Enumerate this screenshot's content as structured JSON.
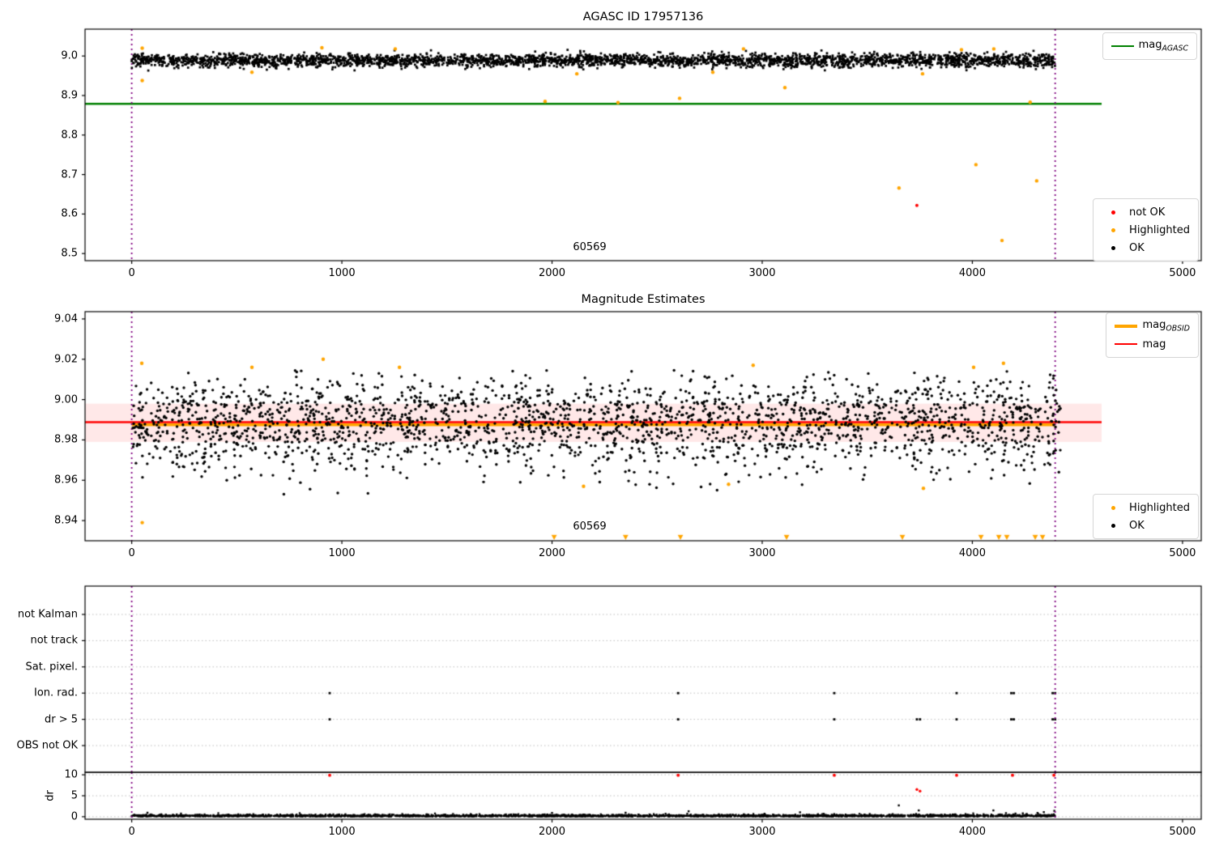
{
  "colors": {
    "green": "#008000",
    "red": "#ff0000",
    "orange": "#ffa500",
    "purple": "#800080",
    "black": "#000000",
    "band_fill": "rgba(255,0,0,0.09)",
    "grid": "#bcbcbc"
  },
  "chart_data": [
    {
      "type": "scatter",
      "title": "AGASC ID 17957136",
      "annotation": "60569",
      "xlim": [
        -222,
        5089
      ],
      "ylim": [
        8.482,
        9.068
      ],
      "xticks": [
        {
          "v": 0,
          "label": "0"
        },
        {
          "v": 1000,
          "label": "1000"
        },
        {
          "v": 2000,
          "label": "2000"
        },
        {
          "v": 3000,
          "label": "3000"
        },
        {
          "v": 4000,
          "label": "4000"
        },
        {
          "v": 5000,
          "label": "5000"
        }
      ],
      "yticks": [
        {
          "v": 9.0,
          "label": "9.0"
        },
        {
          "v": 8.9,
          "label": "8.9"
        },
        {
          "v": 8.8,
          "label": "8.8"
        },
        {
          "v": 8.7,
          "label": "8.7"
        },
        {
          "v": 8.6,
          "label": "8.6"
        },
        {
          "v": 8.5,
          "label": "8.5"
        }
      ],
      "agasc_mag_line": {
        "y": 8.879,
        "x_start": -222,
        "x_end": 4615
      },
      "vlines": [
        0,
        4394
      ],
      "ok_band": {
        "n": 3200,
        "x_min": 0,
        "x_max": 4394,
        "mean": 8.989,
        "sigma": 0.0085,
        "clip": [
          8.958,
          9.016
        ]
      },
      "highlighted": [
        [
          50,
          9.02
        ],
        [
          572,
          8.959
        ],
        [
          905,
          9.021
        ],
        [
          1254,
          9.018
        ],
        [
          1967,
          8.885
        ],
        [
          2118,
          8.955
        ],
        [
          2314,
          8.882
        ],
        [
          2607,
          8.893
        ],
        [
          2765,
          8.959
        ],
        [
          2911,
          9.018
        ],
        [
          3108,
          8.92
        ],
        [
          3651,
          8.666
        ],
        [
          3763,
          8.955
        ],
        [
          3948,
          9.016
        ],
        [
          4017,
          8.725
        ],
        [
          4102,
          9.018
        ],
        [
          4141,
          8.533
        ],
        [
          4275,
          8.883
        ],
        [
          4306,
          8.684
        ],
        [
          50,
          8.938
        ]
      ],
      "not_ok": [
        [
          3736,
          8.622
        ]
      ],
      "legend_line": {
        "main": "mag",
        "sub": "AGASC"
      },
      "legend_markers": [
        {
          "label": "not OK",
          "color": "#ff0000"
        },
        {
          "label": "Highlighted",
          "color": "#ffa500"
        },
        {
          "label": "OK",
          "color": "#000000"
        }
      ]
    },
    {
      "type": "scatter",
      "title": "Magnitude Estimates",
      "annotation": "60569",
      "xlim": [
        -222,
        5089
      ],
      "ylim": [
        8.93,
        9.0436
      ],
      "xticks": [
        {
          "v": 0,
          "label": "0"
        },
        {
          "v": 1000,
          "label": "1000"
        },
        {
          "v": 2000,
          "label": "2000"
        },
        {
          "v": 3000,
          "label": "3000"
        },
        {
          "v": 4000,
          "label": "4000"
        },
        {
          "v": 5000,
          "label": "5000"
        }
      ],
      "yticks": [
        {
          "v": 9.04,
          "label": "9.04"
        },
        {
          "v": 9.02,
          "label": "9.02"
        },
        {
          "v": 9.0,
          "label": "9.00"
        },
        {
          "v": 8.98,
          "label": "8.98"
        },
        {
          "v": 8.96,
          "label": "8.96"
        },
        {
          "v": 8.94,
          "label": "8.94"
        }
      ],
      "mag_line": {
        "y": 8.9888,
        "x_start": -222,
        "x_end": 4615
      },
      "mag_band": {
        "top": 8.998,
        "bottom": 8.979,
        "x_start": -222,
        "x_end": 4615
      },
      "obsid_line": {
        "y": 8.988,
        "x_start": 0,
        "x_end": 4394
      },
      "vlines": [
        0,
        4394
      ],
      "ok_band": {
        "n": 2400,
        "x_min": 0,
        "x_max": 4420,
        "mean": 8.9885,
        "sigma": 0.0118,
        "clip": [
          8.953,
          9.0145
        ]
      },
      "highlighted": [
        [
          48,
          9.018
        ],
        [
          572,
          9.016
        ],
        [
          911,
          9.02
        ],
        [
          1274,
          9.016
        ],
        [
          2957,
          9.017
        ],
        [
          4006,
          9.016
        ],
        [
          4148,
          9.018
        ],
        [
          50,
          8.939
        ],
        [
          2150,
          8.957
        ],
        [
          2840,
          8.958
        ],
        [
          3767,
          8.956
        ]
      ],
      "clipped_low_triangles_x": [
        2010,
        2350,
        2611,
        3116,
        3667,
        4041,
        4126,
        4164,
        4299,
        4334
      ],
      "legend_lines": [
        {
          "main": "mag",
          "sub": "OBSID",
          "color": "#ffa500"
        },
        {
          "main": "mag",
          "sub": "",
          "color": "#ff0000"
        }
      ],
      "legend_markers": [
        {
          "label": "Highlighted",
          "color": "#ffa500"
        },
        {
          "label": "OK",
          "color": "#000000"
        }
      ]
    },
    {
      "type": "scatter-flags",
      "categories": [
        "not Kalman",
        "not track",
        "Sat. pixel.",
        "Ion. rad.",
        "dr > 5",
        "OBS not OK"
      ],
      "xlim": [
        -222,
        5089
      ],
      "xticks": [
        {
          "v": 0,
          "label": "0"
        },
        {
          "v": 1000,
          "label": "1000"
        },
        {
          "v": 2000,
          "label": "2000"
        },
        {
          "v": 3000,
          "label": "3000"
        },
        {
          "v": 4000,
          "label": "4000"
        },
        {
          "v": 5000,
          "label": "5000"
        }
      ],
      "vlines": [
        0,
        4394
      ],
      "flags": {
        "ion_rad_x": [
          942,
          2600,
          3343,
          3925,
          4185,
          4197,
          4382,
          4394
        ],
        "dr_gt5_x": [
          942,
          2600,
          3343,
          3736,
          3751,
          3925,
          4185,
          4197,
          4382,
          4394
        ]
      },
      "dr_axis": {
        "label": "dr",
        "ylim": [
          -0.6,
          10.6
        ],
        "yticks": [
          {
            "v": 10,
            "label": "10"
          },
          {
            "v": 5,
            "label": "5"
          },
          {
            "v": 0,
            "label": "0"
          }
        ],
        "band": {
          "n": 2800,
          "x_min": 0,
          "x_max": 4394,
          "base": 0.06,
          "spread": 0.21,
          "clip": [
            0,
            0.9
          ]
        },
        "extras_black": [
          [
            75,
            0.95
          ],
          [
            2000,
            0.9
          ],
          [
            2350,
            0.95
          ],
          [
            2650,
            1.3
          ],
          [
            3180,
            1.05
          ],
          [
            3650,
            2.7
          ],
          [
            3745,
            1.5
          ],
          [
            4100,
            1.5
          ],
          [
            4160,
            0.85
          ],
          [
            4205,
            0.75
          ],
          [
            4240,
            0.8
          ],
          [
            4310,
            0.9
          ],
          [
            4340,
            1.1
          ],
          [
            4390,
            1.4
          ]
        ],
        "red_at_10": {
          "y": 9.9,
          "x": [
            942,
            2600,
            3343,
            3925,
            4191,
            4388
          ]
        },
        "red_mid": [
          [
            3736,
            6.5
          ],
          [
            3751,
            6.1
          ]
        ]
      }
    }
  ]
}
